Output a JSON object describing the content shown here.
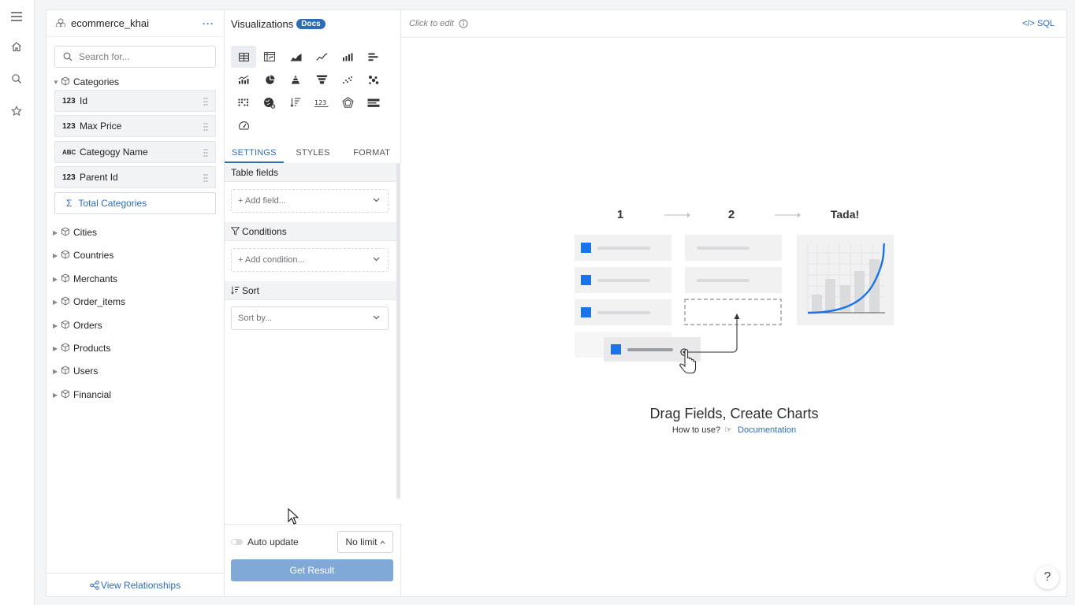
{
  "data_model": {
    "title": "ecommerce_khai",
    "more_label": "···",
    "search_placeholder": "Search for...",
    "expanded": {
      "name": "Categories",
      "fields": [
        {
          "type": "123",
          "name": "Id"
        },
        {
          "type": "123",
          "name": "Max Price"
        },
        {
          "type": "ABC",
          "name": "Categogy Name"
        },
        {
          "type": "123",
          "name": "Parent Id"
        }
      ],
      "metric": "Total Categories"
    },
    "models": [
      "Cities",
      "Countries",
      "Merchants",
      "Order_items",
      "Orders",
      "Products",
      "Users",
      "Financial"
    ],
    "footer_link": "View Relationships"
  },
  "viz": {
    "title": "Visualizations",
    "docs_badge": "Docs",
    "chart_types": [
      "table-icon",
      "pivot-table-icon",
      "area-chart-icon",
      "line-chart-icon",
      "column-chart-icon",
      "bar-chart-icon",
      "combo-chart-icon",
      "pie-chart-icon",
      "pyramid-chart-icon",
      "funnel-chart-icon",
      "scatter-chart-icon",
      "bubble-chart-icon",
      "heatmap-icon",
      "map-icon",
      "sorted-list-icon",
      "kpi-number-icon",
      "radar-chart-icon",
      "bullet-chart-icon",
      "gauge-icon"
    ],
    "tabs": [
      "SETTINGS",
      "STYLES",
      "FORMAT"
    ],
    "active_tab": "SETTINGS",
    "sections": {
      "table_fields": {
        "title": "Table fields",
        "placeholder": "+ Add field..."
      },
      "conditions": {
        "title": "Conditions",
        "placeholder": "+ Add condition..."
      },
      "sort": {
        "title": "Sort",
        "placeholder": "Sort by..."
      }
    },
    "auto_update_label": "Auto update",
    "limit_label": "No limit",
    "get_result_label": "Get Result"
  },
  "canvas": {
    "click_to_edit": "Click to edit",
    "sql_label": "SQL",
    "steps": [
      "1",
      "2",
      "Tada!"
    ],
    "headline": "Drag Fields, Create Charts",
    "how_to": "How to use?",
    "doc_link": "Documentation",
    "help_label": "?"
  },
  "colors": {
    "accent": "#2e6db4",
    "get_result_bg": "#80a9d7",
    "illustration_blue": "#1a73e8"
  }
}
